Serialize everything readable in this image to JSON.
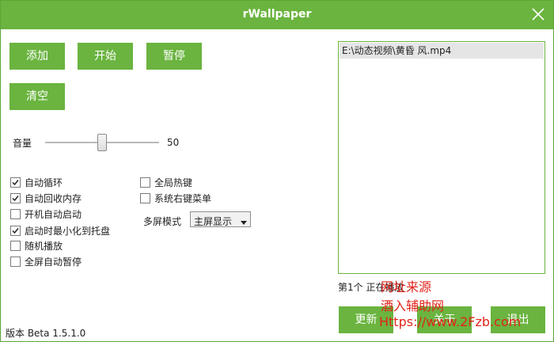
{
  "window": {
    "title": "rWallpaper"
  },
  "buttons": {
    "add": "添加",
    "start": "开始",
    "pause": "暂停",
    "clear": "清空",
    "update": "更新",
    "about": "关于",
    "exit": "退出"
  },
  "volume": {
    "label": "音量",
    "value": 50,
    "value_text": "50",
    "max": 100
  },
  "options": [
    {
      "label": "自动循环",
      "checked": true
    },
    {
      "label": "自动回收内存",
      "checked": true
    },
    {
      "label": "开机自动启动",
      "checked": false
    },
    {
      "label": "启动时最小化到托盘",
      "checked": true
    },
    {
      "label": "随机播放",
      "checked": false
    },
    {
      "label": "全屏自动暂停",
      "checked": false
    }
  ],
  "options_right": [
    {
      "label": "全局热键",
      "checked": false
    },
    {
      "label": "系统右键菜单",
      "checked": false
    }
  ],
  "multiscreen": {
    "label": "多屏模式",
    "selected": "主屏显示"
  },
  "playlist": {
    "items": [
      "E:\\动态视频\\黄昏 风.mp4"
    ]
  },
  "status": {
    "text": "第1个  正在播放"
  },
  "version": {
    "text": "版本 Beta 1.5.1.0"
  },
  "watermark": {
    "line1": "网址来源",
    "line2": "酒入辅助网",
    "line3": "Https://www.2Fzb.com"
  },
  "colors": {
    "accent": "#6ab43f",
    "watermark": "#e2231a"
  }
}
